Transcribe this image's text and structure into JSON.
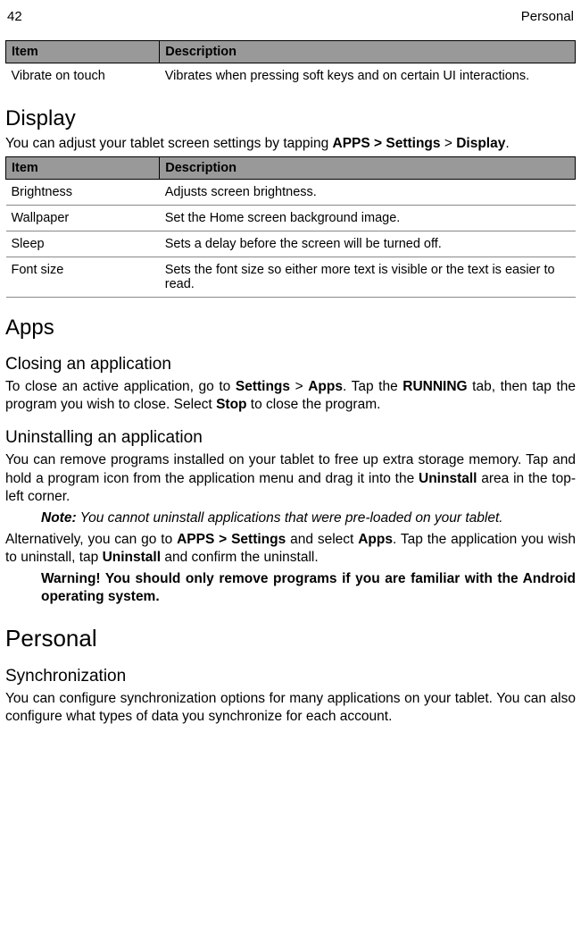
{
  "header": {
    "page_num": "42",
    "section": "Personal"
  },
  "table1": {
    "head_item": "Item",
    "head_desc": "Description",
    "r1c1": "Vibrate on touch",
    "r1c2": "Vibrates when pressing soft keys and on certain UI interactions."
  },
  "display": {
    "heading": "Display",
    "intro_a": "You can adjust your tablet screen settings by tapping ",
    "intro_b": "APPS > Settings",
    "intro_c": " > ",
    "intro_d": "Display",
    "intro_e": "."
  },
  "table2": {
    "head_item": "Item",
    "head_desc": "Description",
    "r1c1": "Brightness",
    "r1c2": "Adjusts screen brightness.",
    "r2c1": "Wallpaper",
    "r2c2": "Set the Home screen background image.",
    "r3c1": "Sleep",
    "r3c2": "Sets a delay before the screen will be turned off.",
    "r4c1": "Font size",
    "r4c2": "Sets the font size so either more text is visible or the text is easier to read."
  },
  "apps": {
    "heading": "Apps",
    "closing_h": "Closing an application",
    "closing_a": "To close an active application, go to ",
    "closing_b": "Settings",
    "closing_c": " > ",
    "closing_d": "Apps",
    "closing_e": ". Tap the ",
    "closing_f": "RUNNING",
    "closing_g": " tab, then tap the program you wish to close. Select ",
    "closing_h2": "Stop",
    "closing_i": " to close the program.",
    "uninst_h": "Uninstalling an application",
    "uninst_p1a": "You can remove programs installed on your tablet to free up extra storage memory. Tap and hold a program icon from the application menu and drag it into the ",
    "uninst_p1b": "Uninstall",
    "uninst_p1c": " area in the top-left corner.",
    "note_a": "Note:",
    "note_b": " You cannot uninstall applications that were pre-loaded on your tablet.",
    "alt_a": "Alternatively, you can go to ",
    "alt_b": "APPS > Settings",
    "alt_c": " and select ",
    "alt_d": "Apps",
    "alt_e": ". Tap the application you wish to uninstall, tap ",
    "alt_f": "Uninstall",
    "alt_g": " and confirm the uninstall.",
    "warn": "Warning! You should only remove programs if you are familiar with the Android operating system."
  },
  "personal": {
    "heading": "Personal",
    "sync_h": "Synchronization",
    "sync_p": "You can configure synchronization options for many applications on your tablet. You can also configure what types of data you synchronize for each account."
  }
}
